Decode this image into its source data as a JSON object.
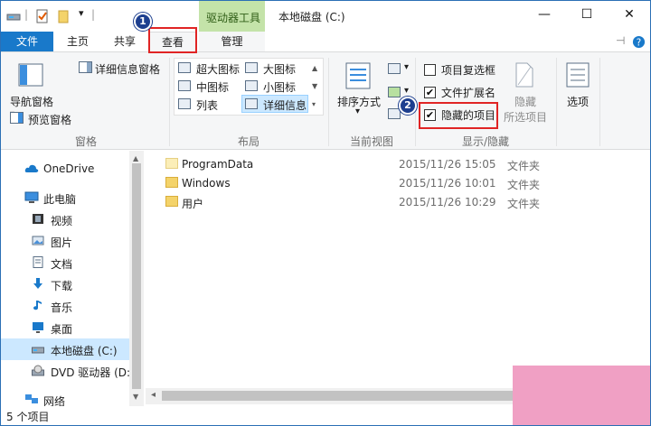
{
  "window": {
    "title": "本地磁盘 (C:)",
    "contextual_tab": "驱动器工具",
    "controls": {
      "minimize": "—",
      "maximize": "☐",
      "close": "✕",
      "collapse": "∨"
    }
  },
  "tabs": {
    "file": "文件",
    "home": "主页",
    "share": "共享",
    "view": "查看",
    "manage": "管理"
  },
  "ribbon": {
    "panes": {
      "label": "窗格",
      "nav_pane": "导航窗格",
      "preview_pane": "预览窗格",
      "details_pane": "详细信息窗格"
    },
    "layout": {
      "label": "布局",
      "items": [
        "超大图标",
        "大图标",
        "中图标",
        "小图标",
        "列表",
        "详细信息"
      ]
    },
    "current_view": {
      "label": "当前视图",
      "sort_by": "排序方式"
    },
    "show_hide": {
      "label": "显示/隐藏",
      "item_checkboxes": {
        "label": "项目复选框",
        "checked": false
      },
      "file_extensions": {
        "label": "文件扩展名",
        "checked": true
      },
      "hidden_items": {
        "label": "隐藏的项目",
        "checked": true
      },
      "hide_selected_1": "隐藏",
      "hide_selected_2": "所选项目",
      "checkmark": "✔"
    },
    "options": "选项"
  },
  "badges": {
    "one": "1",
    "two": "2"
  },
  "nav": {
    "items": [
      {
        "label": "OneDrive",
        "icon": "cloud-icon"
      },
      {
        "label": "此电脑",
        "icon": "computer-icon"
      },
      {
        "label": "视频",
        "icon": "video-icon"
      },
      {
        "label": "图片",
        "icon": "picture-icon"
      },
      {
        "label": "文档",
        "icon": "document-icon"
      },
      {
        "label": "下载",
        "icon": "download-icon"
      },
      {
        "label": "音乐",
        "icon": "music-icon"
      },
      {
        "label": "桌面",
        "icon": "desktop-icon"
      },
      {
        "label": "本地磁盘 (C:)",
        "icon": "drive-icon"
      },
      {
        "label": "DVD 驱动器 (D:",
        "icon": "dvd-icon"
      },
      {
        "label": "网络",
        "icon": "network-icon"
      }
    ]
  },
  "files": [
    {
      "name": "ProgramData",
      "date": "2015/11/26 15:05",
      "type": "文件夹"
    },
    {
      "name": "Windows",
      "date": "2015/11/26 10:01",
      "type": "文件夹"
    },
    {
      "name": "用户",
      "date": "2015/11/26 10:29",
      "type": "文件夹"
    }
  ],
  "status": {
    "count": "5 个项目"
  },
  "colors": {
    "accent": "#1979ca",
    "highlight": "#e02424",
    "badge": "#1d3f8f",
    "contextual": "#c4e3a9"
  }
}
